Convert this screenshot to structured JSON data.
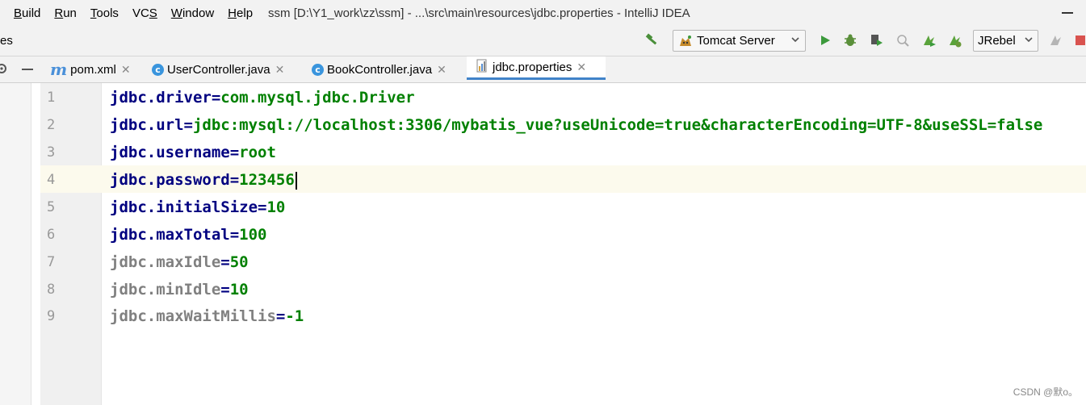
{
  "menu": {
    "items": [
      {
        "label": "Build",
        "mnemonic": "B",
        "rest": "uild"
      },
      {
        "label": "Run",
        "mnemonic": "R",
        "rest": "un"
      },
      {
        "label": "Tools",
        "mnemonic": "T",
        "rest": "ools"
      },
      {
        "label": "VCS",
        "mnemonic": "S",
        "rest": "VC"
      },
      {
        "label": "Window",
        "mnemonic": "W",
        "rest": "indow"
      },
      {
        "label": "Help",
        "mnemonic": "H",
        "rest": "elp"
      }
    ],
    "window_title": "ssm [D:\\Y1_work\\zz\\ssm] - ...\\src\\main\\resources\\jdbc.properties - IntelliJ IDEA"
  },
  "toolbar": {
    "crumb_tail": "es",
    "run_config": "Tomcat Server",
    "jrebel": "JRebel",
    "icons": [
      "build-hammer-icon",
      "tomcat-icon",
      "run-icon",
      "debug-icon",
      "coverage-icon",
      "profile-icon",
      "jrebel-run-icon",
      "jrebel-debug-icon",
      "update-icon",
      "stop-icon"
    ],
    "colors": {
      "run": "#3c9a3c",
      "stop": "#d9534f",
      "jrebel": "#5aa33b"
    }
  },
  "tabs": [
    {
      "label": "pom.xml",
      "icon": "maven-m-icon",
      "active": false
    },
    {
      "label": "UserController.java",
      "icon": "class-c-icon",
      "active": false
    },
    {
      "label": "BookController.java",
      "icon": "class-c-icon",
      "active": false
    },
    {
      "label": "jdbc.properties",
      "icon": "properties-file-icon",
      "active": true
    }
  ],
  "editor": {
    "lines": [
      {
        "num": "1",
        "key": "jdbc.driver",
        "eq": "=",
        "value": "com.mysql.jdbc.Driver",
        "dim": false
      },
      {
        "num": "2",
        "key": "jdbc.url",
        "eq": "=",
        "value": "jdbc:mysql://localhost:3306/mybatis_vue?useUnicode=true&characterEncoding=UTF-8&useSSL=false",
        "dim": false
      },
      {
        "num": "3",
        "key": "jdbc.username",
        "eq": "=",
        "value": "root",
        "dim": false
      },
      {
        "num": "4",
        "key": "jdbc.password",
        "eq": "=",
        "value": "123456",
        "dim": false
      },
      {
        "num": "5",
        "key": "jdbc.initialSize",
        "eq": "=",
        "value": "10",
        "dim": false
      },
      {
        "num": "6",
        "key": "jdbc.maxTotal",
        "eq": "=",
        "value": "100",
        "dim": false
      },
      {
        "num": "7",
        "key": "jdbc.maxIdle",
        "eq": "=",
        "value": "50",
        "dim": true
      },
      {
        "num": "8",
        "key": "jdbc.minIdle",
        "eq": "=",
        "value": "10",
        "dim": true
      },
      {
        "num": "9",
        "key": "jdbc.maxWaitMillis",
        "eq": "=",
        "value": "-1",
        "dim": true
      }
    ],
    "current_line": "4",
    "colors": {
      "key": "#000080",
      "dim_key": "#808080",
      "value": "#008000"
    }
  },
  "watermark": "CSDN @默o。"
}
